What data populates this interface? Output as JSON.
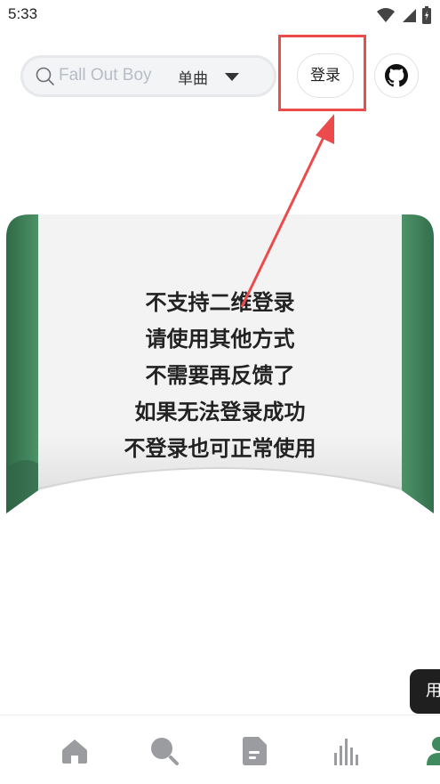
{
  "status_bar": {
    "time": "5:33"
  },
  "search": {
    "placeholder": "Fall Out Boy",
    "type_label": "单曲"
  },
  "header": {
    "login_label": "登录"
  },
  "banner": {
    "lines": [
      "不支持二维登录",
      "请使用其他方式",
      "不需要再反馈了",
      "如果无法登录成功",
      "不登录也可正常使用"
    ]
  },
  "floating": {
    "label": "用"
  },
  "bottom_nav": {
    "items": [
      {
        "name": "home-icon",
        "active": false
      },
      {
        "name": "search-icon",
        "active": false
      },
      {
        "name": "document-icon",
        "active": false
      },
      {
        "name": "chart-icon",
        "active": false
      },
      {
        "name": "user-icon",
        "active": true
      }
    ]
  },
  "colors": {
    "accent_green": "#3f8a5f",
    "annotation_red": "#ec4b4b",
    "icon_gray": "#9a9ca0"
  }
}
